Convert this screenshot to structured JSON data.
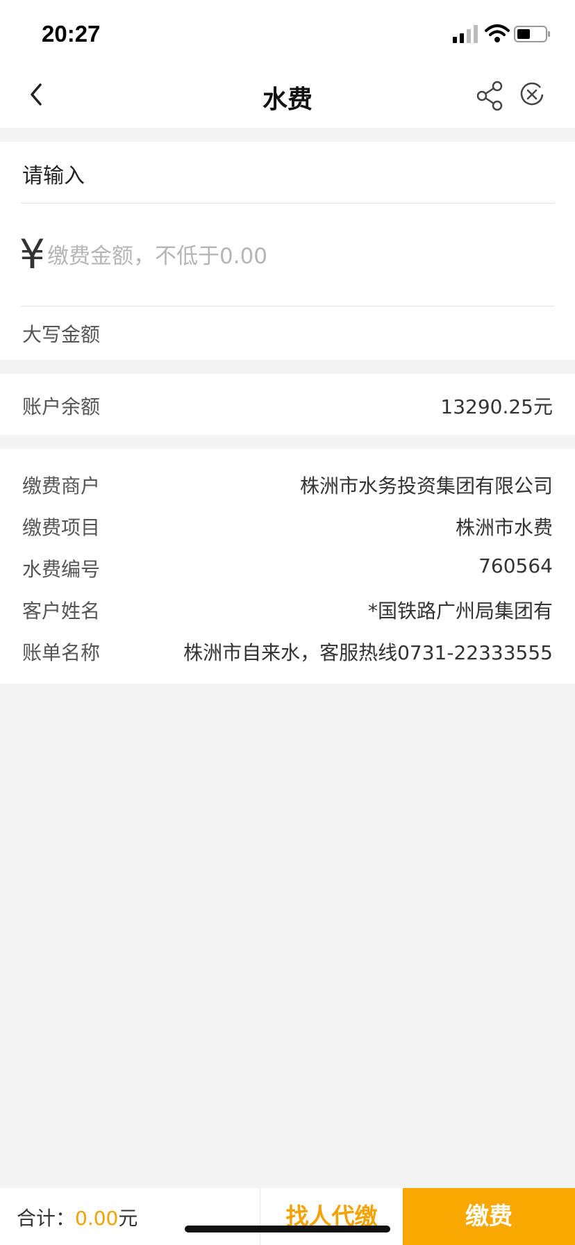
{
  "status_bar": {
    "time": "20:27"
  },
  "nav": {
    "title": "水费",
    "icons": [
      "back-icon",
      "share-icon",
      "close-icon"
    ]
  },
  "input_card": {
    "label": "请输入",
    "currency_symbol": "¥",
    "amount_placeholder": "缴费金额，不低于0.00",
    "uppercase_label": "大写金额"
  },
  "balance": {
    "label": "账户余额",
    "value": "13290.25元"
  },
  "info": {
    "rows": [
      {
        "label": "缴费商户",
        "value": "株洲市水务投资集团有限公司"
      },
      {
        "label": "缴费项目",
        "value": "株洲市水费"
      },
      {
        "label": "水费编号",
        "value": "760564"
      },
      {
        "label": "客户姓名",
        "value": "*国铁路广州局集团有"
      },
      {
        "label": "账单名称",
        "value": "株洲市自来水，客服热线0731-22333555"
      }
    ]
  },
  "bottom_bar": {
    "total_label": "合计：",
    "total_value": "0.00",
    "total_unit": "元",
    "find_pay_label": "找人代缴",
    "pay_label": "缴费"
  },
  "colors": {
    "accent": "#f8a800",
    "background": "#f3f3f3"
  }
}
